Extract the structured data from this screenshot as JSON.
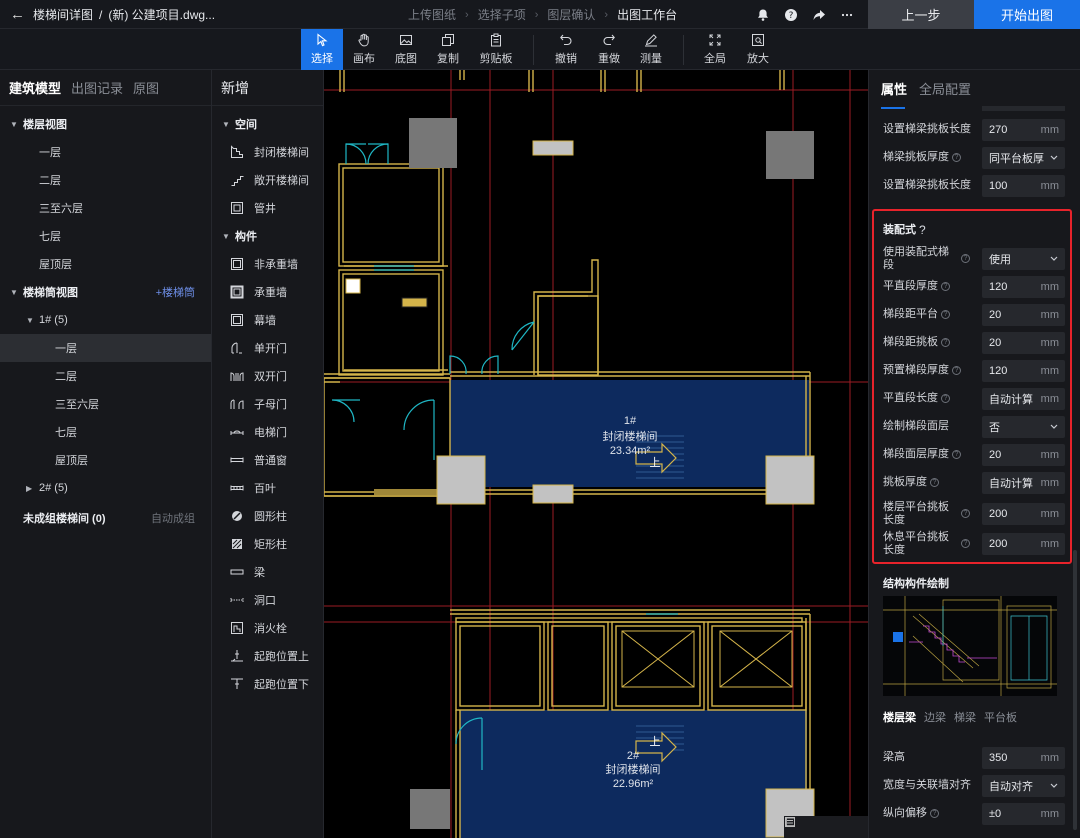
{
  "header": {
    "back_title": "楼梯间详图",
    "separator": "/",
    "project": "(新) 公建项目.dwg...",
    "steps": [
      "上传图纸",
      "选择子项",
      "图层确认",
      "出图工作台"
    ],
    "prev_label": "上一步",
    "start_label": "开始出图"
  },
  "toolbar": {
    "items": [
      {
        "id": "select",
        "label": "选择"
      },
      {
        "id": "canvas",
        "label": "画布"
      },
      {
        "id": "base",
        "label": "底图"
      },
      {
        "id": "copy",
        "label": "复制"
      },
      {
        "id": "clipboard",
        "label": "剪贴板"
      },
      {
        "id": "undo",
        "label": "撤销"
      },
      {
        "id": "redo",
        "label": "重做"
      },
      {
        "id": "measure",
        "label": "测量"
      },
      {
        "id": "full",
        "label": "全局"
      },
      {
        "id": "zoom",
        "label": "放大"
      }
    ]
  },
  "left_panel": {
    "tabs": [
      "建筑模型",
      "出图记录",
      "原图"
    ],
    "tree": [
      {
        "label": "楼层视图",
        "bold": true
      },
      {
        "label": "一层"
      },
      {
        "label": "二层"
      },
      {
        "label": "三至六层"
      },
      {
        "label": "七层"
      },
      {
        "label": "屋顶层"
      },
      {
        "label": "楼梯筒视图",
        "bold": true,
        "action": "+楼梯筒"
      },
      {
        "label": "1# (5)"
      },
      {
        "label": "一层",
        "selected": true
      },
      {
        "label": "二层"
      },
      {
        "label": "三至六层"
      },
      {
        "label": "七层"
      },
      {
        "label": "屋顶层"
      },
      {
        "label": "2# (5)"
      },
      {
        "label": "未成组楼梯间 (0)",
        "bold": true,
        "action": "自动成组"
      }
    ]
  },
  "mid_panel": {
    "title": "新增",
    "groups": [
      {
        "title": "空间",
        "items": [
          "封闭楼梯间",
          "敞开楼梯间",
          "管井"
        ]
      },
      {
        "title": "构件",
        "items": [
          "非承重墙",
          "承重墙",
          "幕墙",
          "单开门",
          "双开门",
          "子母门",
          "电梯门",
          "普通窗",
          "百叶",
          "圆形柱",
          "矩形柱",
          "梁",
          "洞口",
          "消火栓",
          "起跑位置上",
          "起跑位置下"
        ]
      }
    ]
  },
  "canvas": {
    "room1": {
      "id": "1#",
      "type": "封闭楼梯间",
      "area": "23.34m²",
      "up": "上"
    },
    "room2": {
      "id": "2#",
      "type": "封闭楼梯间",
      "area": "22.96m²",
      "up": "上"
    }
  },
  "right_panel": {
    "tabs": [
      "属性",
      "全局配置"
    ],
    "props_top": [
      {
        "label": "设置梯梁挑板长度",
        "value": "270",
        "unit": "mm"
      },
      {
        "label": "梯梁挑板厚度",
        "value": "同平台板厚",
        "dropdown": true,
        "help": true
      },
      {
        "label": "设置梯梁挑板长度",
        "value": "100",
        "unit": "mm"
      }
    ],
    "prefab": {
      "title": "装配式",
      "props": [
        {
          "label": "使用装配式梯段",
          "value": "使用",
          "dropdown": true
        },
        {
          "label": "平直段厚度",
          "value": "120",
          "unit": "mm"
        },
        {
          "label": "梯段距平台",
          "value": "20",
          "unit": "mm"
        },
        {
          "label": "梯段距挑板",
          "value": "20",
          "unit": "mm"
        },
        {
          "label": "预置梯段厚度",
          "value": "120",
          "unit": "mm"
        },
        {
          "label": "平直段长度",
          "value": "自动计算",
          "unit": "mm"
        },
        {
          "label": "绘制梯段面层",
          "value": "否",
          "dropdown": true
        },
        {
          "label": "梯段面层厚度",
          "value": "20",
          "unit": "mm"
        },
        {
          "label": "挑板厚度",
          "value": "自动计算",
          "unit": "mm"
        },
        {
          "label": "楼层平台挑板长度",
          "value": "200",
          "unit": "mm"
        },
        {
          "label": "休息平台挑板长度",
          "value": "200",
          "unit": "mm"
        }
      ]
    },
    "struct_title": "结构构件绘制",
    "beam_tabs": [
      "楼层梁",
      "边梁",
      "梯梁",
      "平台板"
    ],
    "props_bottom": [
      {
        "label": "梁高",
        "value": "350",
        "unit": "mm"
      },
      {
        "label": "宽度与关联墙对齐",
        "value": "自动对齐",
        "dropdown": true
      },
      {
        "label": "纵向偏移",
        "value": "±0",
        "unit": "mm",
        "help": true
      }
    ]
  },
  "colors": {
    "accent": "#1a73e8",
    "highlight": "#e8232b",
    "wall": "#d4b44a",
    "room_fill": "#0d2a5e",
    "cyan": "#1fb6c4",
    "grid_red": "#9c1c24"
  }
}
